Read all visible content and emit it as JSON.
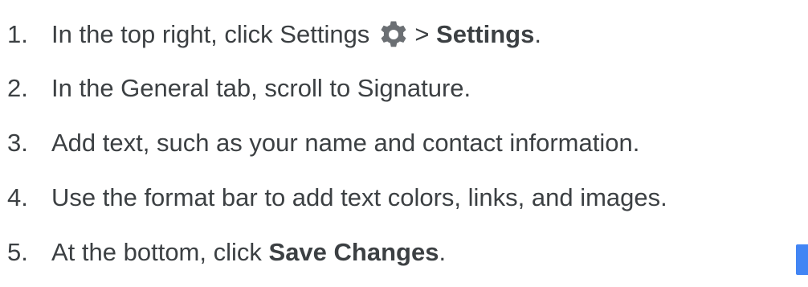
{
  "steps": [
    {
      "number": "1.",
      "text_before": "In the top right, click Settings",
      "icon": "gear-icon",
      "separator": ">",
      "bold": "Settings",
      "text_after": "."
    },
    {
      "number": "2.",
      "text": "In the General tab, scroll to Signature."
    },
    {
      "number": "3.",
      "text": "Add text, such as your name and contact information."
    },
    {
      "number": "4.",
      "text": "Use the format bar to add text colors, links, and images."
    },
    {
      "number": "5.",
      "text_before": "At the bottom, click",
      "bold": "Save Changes",
      "text_after": "."
    }
  ],
  "colors": {
    "text": "#3c4043",
    "gear": "#6b6f73",
    "accent": "#4285f4"
  }
}
